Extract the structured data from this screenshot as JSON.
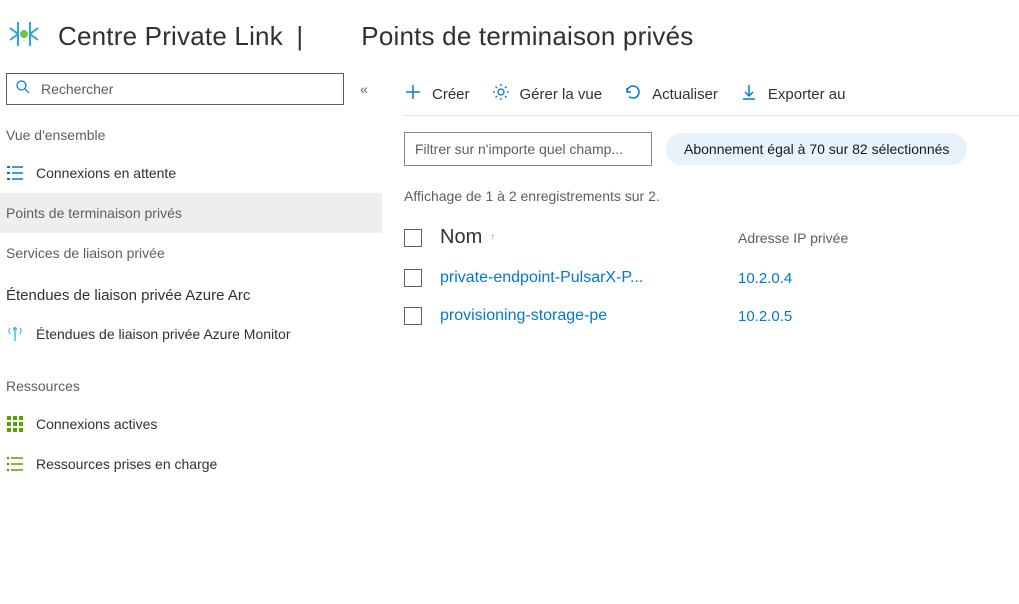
{
  "header": {
    "brand_title": "Centre Private Link",
    "separator": "|",
    "page_title": "Points de terminaison privés"
  },
  "sidebar": {
    "search_placeholder": "Rechercher",
    "collapse_glyph": "«",
    "overview_label": "Vue d'ensemble",
    "items": [
      {
        "label": "Connexions en attente"
      },
      {
        "label": "Points de terminaison privés"
      },
      {
        "label": "Services de liaison privée"
      }
    ],
    "arc_title": "Étendues de liaison privée Azure Arc",
    "arc_items": [
      {
        "label": "Étendues de liaison privée Azure Monitor"
      }
    ],
    "resources_title": "Ressources",
    "resources_items": [
      {
        "label": "Connexions actives"
      },
      {
        "label": "Ressources prises en charge"
      }
    ]
  },
  "toolbar": {
    "create_label": "Créer",
    "manage_view_label": "Gérer la vue",
    "refresh_label": "Actualiser",
    "export_label": "Exporter au"
  },
  "filter": {
    "placeholder": "Filtrer sur n'importe quel champ...",
    "subscription_pill": "Abonnement égal à 70 sur 82 sélectionnés"
  },
  "record_count_text": "Affichage de 1 à 2 enregistrements sur 2.",
  "table": {
    "col_name": "Nom",
    "col_ip": "Adresse IP privée",
    "rows": [
      {
        "name": "private-endpoint-PulsarX-P...",
        "ip": "10.2.0.4"
      },
      {
        "name": "provisioning-storage-pe",
        "ip": "10.2.0.5"
      }
    ]
  }
}
